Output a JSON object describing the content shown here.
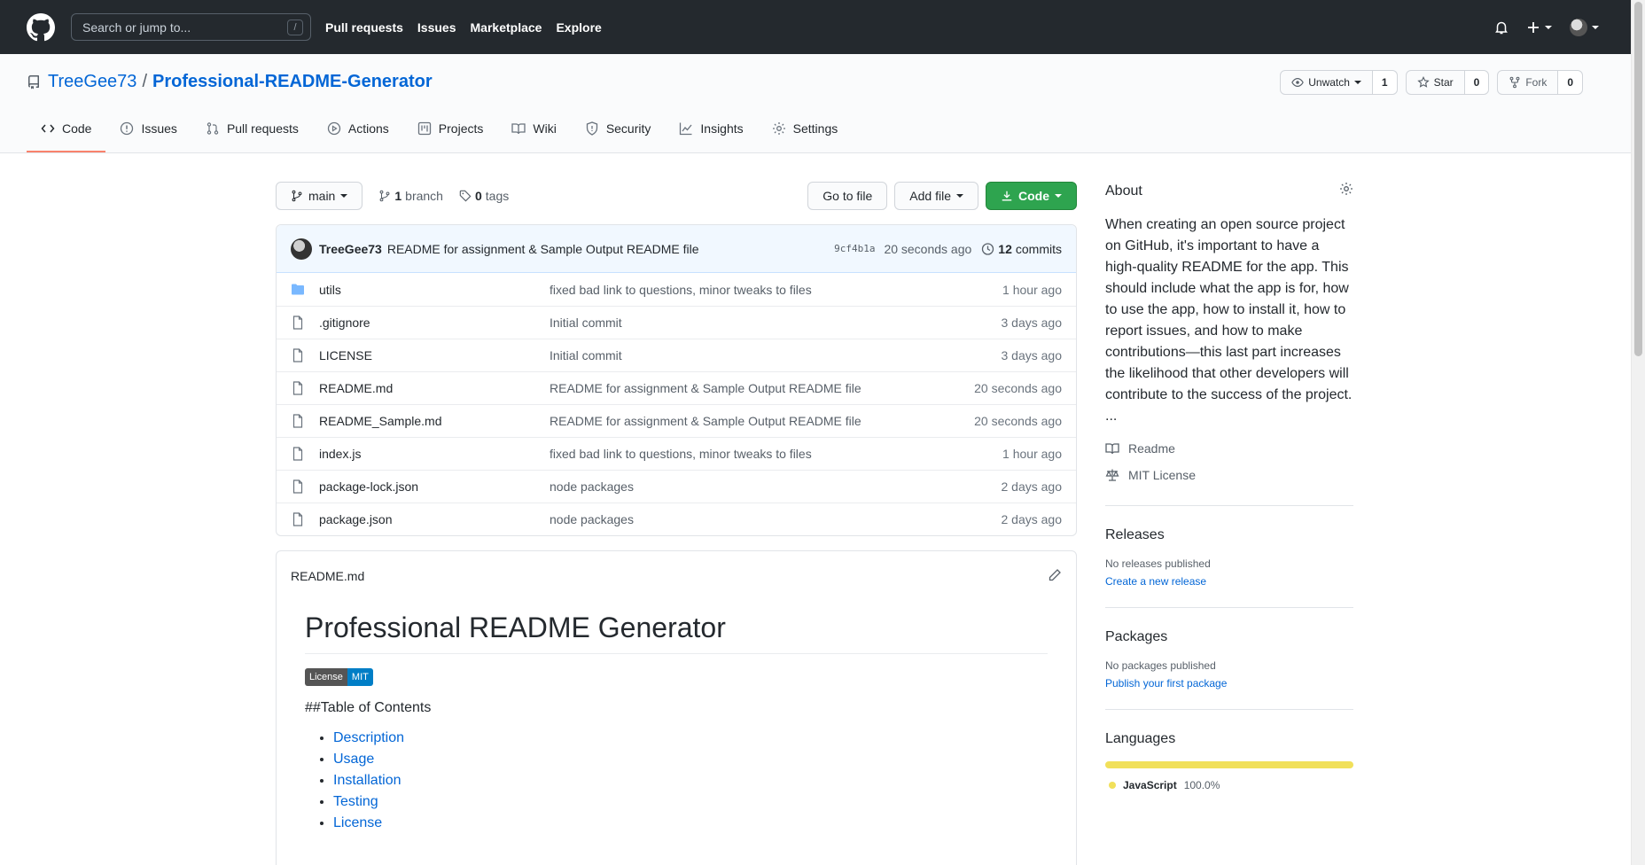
{
  "header": {
    "search_placeholder": "Search or jump to...",
    "search_shortcut": "/",
    "nav": [
      "Pull requests",
      "Issues",
      "Marketplace",
      "Explore"
    ]
  },
  "repo": {
    "owner": "TreeGee73",
    "separator": "/",
    "name": "Professional-README-Generator",
    "watch_label": "Unwatch",
    "watch_count": "1",
    "star_label": "Star",
    "star_count": "0",
    "fork_label": "Fork",
    "fork_count": "0"
  },
  "tabs": [
    "Code",
    "Issues",
    "Pull requests",
    "Actions",
    "Projects",
    "Wiki",
    "Security",
    "Insights",
    "Settings"
  ],
  "file_nav": {
    "branch": "main",
    "branch_count": "1",
    "branch_label": "branch",
    "tag_count": "0",
    "tag_label": "tags",
    "goto_file": "Go to file",
    "add_file": "Add file",
    "code": "Code"
  },
  "commit": {
    "author": "TreeGee73",
    "message": "README for assignment & Sample Output README file",
    "sha": "9cf4b1a",
    "time": "20 seconds ago",
    "count": "12",
    "count_label": "commits"
  },
  "files": [
    {
      "name": "utils",
      "type": "dir",
      "message": "fixed bad link to questions, minor tweaks to files",
      "age": "1 hour ago"
    },
    {
      "name": ".gitignore",
      "type": "file",
      "message": "Initial commit",
      "age": "3 days ago"
    },
    {
      "name": "LICENSE",
      "type": "file",
      "message": "Initial commit",
      "age": "3 days ago"
    },
    {
      "name": "README.md",
      "type": "file",
      "message": "README for assignment & Sample Output README file",
      "age": "20 seconds ago"
    },
    {
      "name": "README_Sample.md",
      "type": "file",
      "message": "README for assignment & Sample Output README file",
      "age": "20 seconds ago"
    },
    {
      "name": "index.js",
      "type": "file",
      "message": "fixed bad link to questions, minor tweaks to files",
      "age": "1 hour ago"
    },
    {
      "name": "package-lock.json",
      "type": "file",
      "message": "node packages",
      "age": "2 days ago"
    },
    {
      "name": "package.json",
      "type": "file",
      "message": "node packages",
      "age": "2 days ago"
    }
  ],
  "readme": {
    "filename": "README.md",
    "title": "Professional README Generator",
    "badge_left": "License",
    "badge_right": "MIT",
    "toc_heading": "##Table of Contents",
    "toc": [
      "Description",
      "Usage",
      "Installation",
      "Testing",
      "License"
    ]
  },
  "sidebar": {
    "about_title": "About",
    "about_text": "When creating an open source project on GitHub, it's important to have a high-quality README for the app. This should include what the app is for, how to use the app, how to install it, how to report issues, and how to make contributions—this last part increases the likelihood that other developers will contribute to the success of the project. ...",
    "readme_link": "Readme",
    "license_link": "MIT License",
    "releases_title": "Releases",
    "releases_none": "No releases published",
    "releases_create": "Create a new release",
    "packages_title": "Packages",
    "packages_none": "No packages published",
    "packages_publish": "Publish your first package",
    "languages_title": "Languages",
    "language": "JavaScript",
    "language_pct": "100.0%",
    "language_color": "#f1e05a"
  },
  "colors": {
    "header_bg": "#24292e",
    "link": "#0366d6",
    "green_button": "#2ea44f",
    "active_tab_underline": "#f9826c"
  }
}
